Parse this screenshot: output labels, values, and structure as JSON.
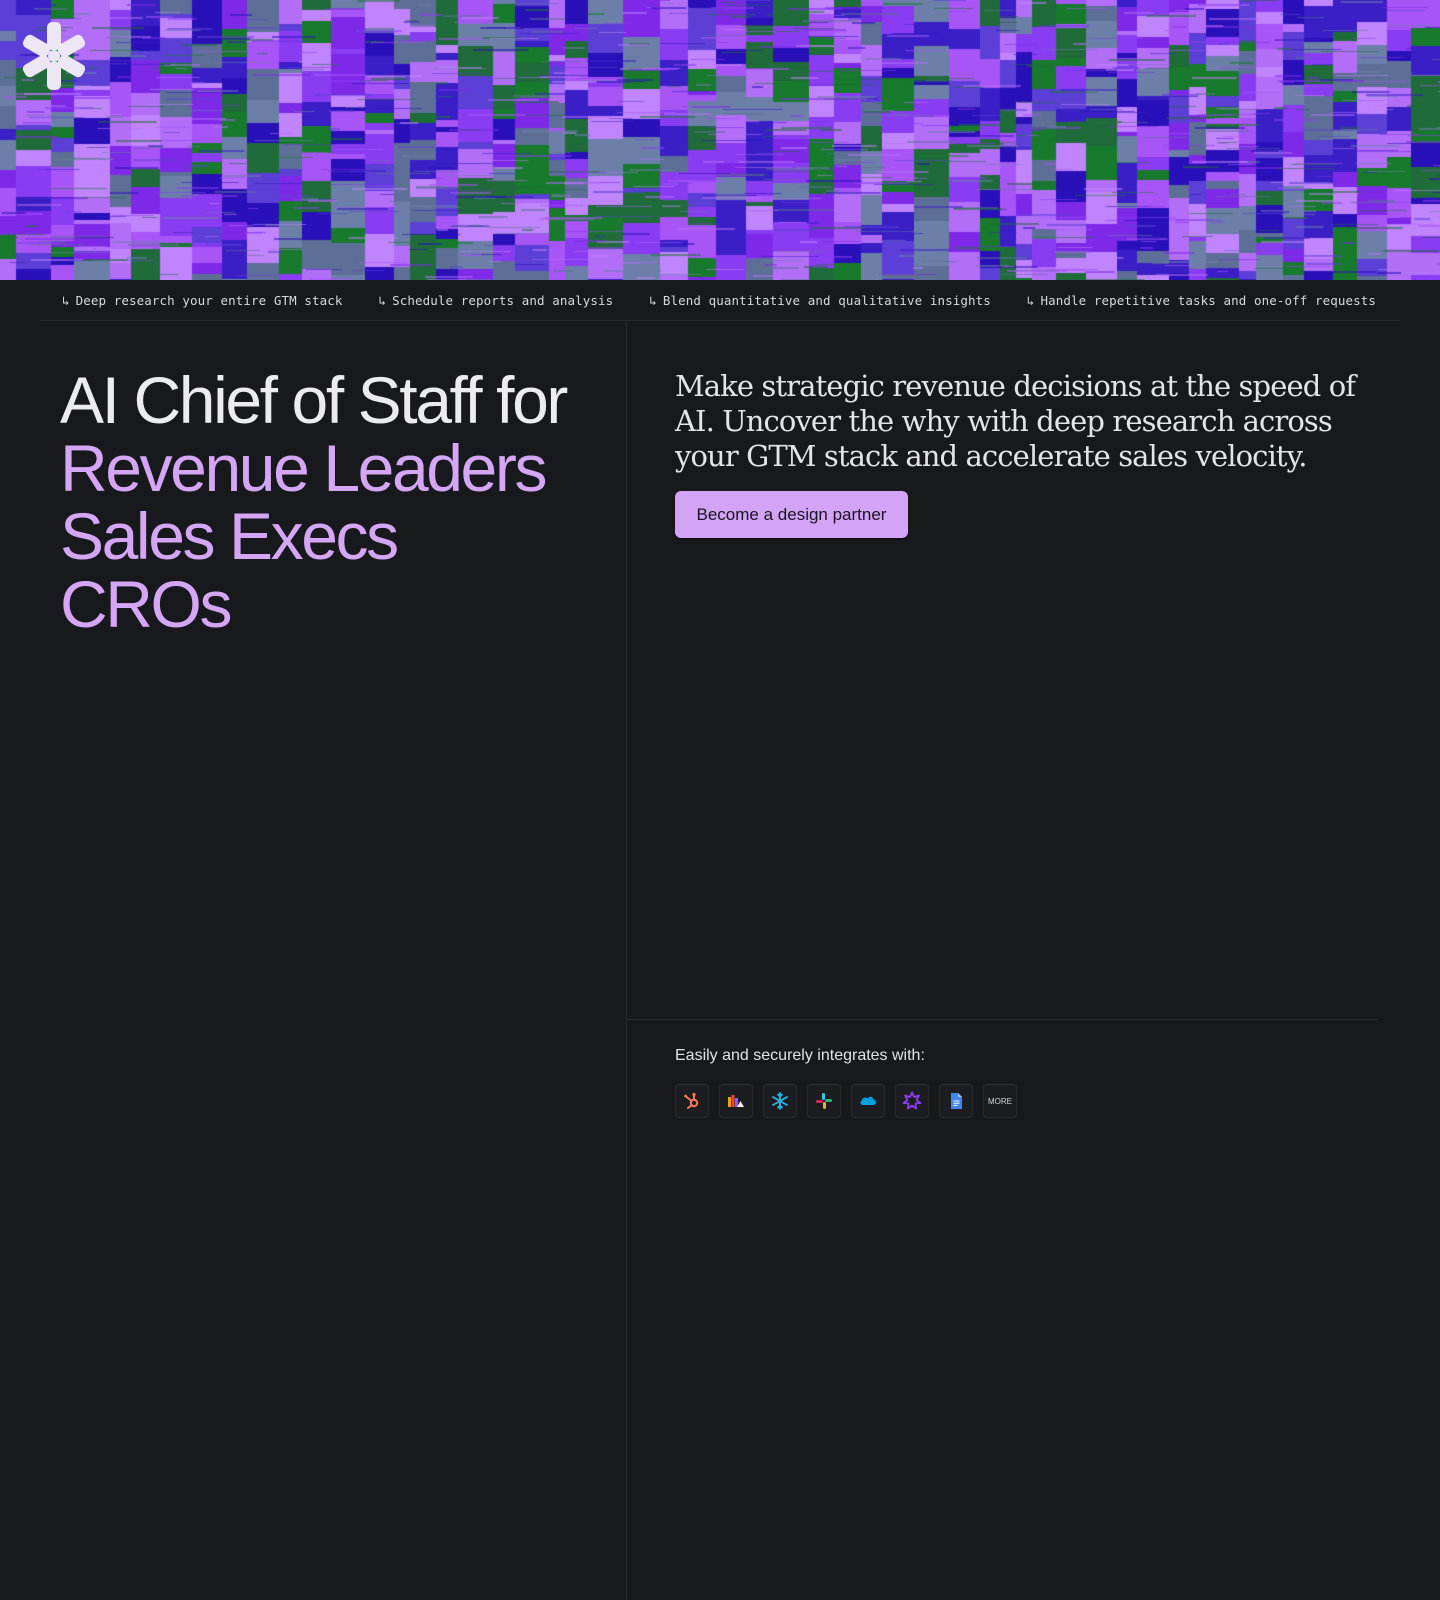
{
  "brand": {
    "logo": "flower-logo-icon",
    "logo_color": "#ece6f5"
  },
  "hero": {
    "palette": [
      "#8a3cf2",
      "#a855f7",
      "#c084fc",
      "#5b3fd6",
      "#3a1fc7",
      "#2a10b8",
      "#1f6b3a",
      "#177a2c",
      "#6b7fa8",
      "#5d6f96",
      "#b36ef8",
      "#7e29e8"
    ]
  },
  "features": [
    {
      "arrow": "↳",
      "label": "Deep research your entire GTM stack"
    },
    {
      "arrow": "↳",
      "label": "Schedule reports and analysis"
    },
    {
      "arrow": "↳",
      "label": "Blend quantitative and qualitative insights"
    },
    {
      "arrow": "↳",
      "label": "Handle repetitive tasks and one-off requests"
    }
  ],
  "headline": {
    "line1": "AI Chief of Staff for",
    "line2": "Revenue Leaders",
    "line3": "Sales Execs",
    "line4": "CROs",
    "accent_color": "#d4a6f5"
  },
  "subcopy": "Make strategic revenue decisions at the speed of AI. Uncover the why with deep research across your GTM stack and accelerate sales velocity.",
  "cta": {
    "label": "Become a design partner",
    "color": "#d3a4f6"
  },
  "integrations": {
    "label": "Easily and securely integrates with:",
    "items": [
      "hubspot-icon",
      "looker-studio-icon",
      "snowflake-icon",
      "slack-icon",
      "salesforce-icon",
      "gong-icon",
      "google-docs-icon"
    ],
    "more_label": "MORE"
  }
}
